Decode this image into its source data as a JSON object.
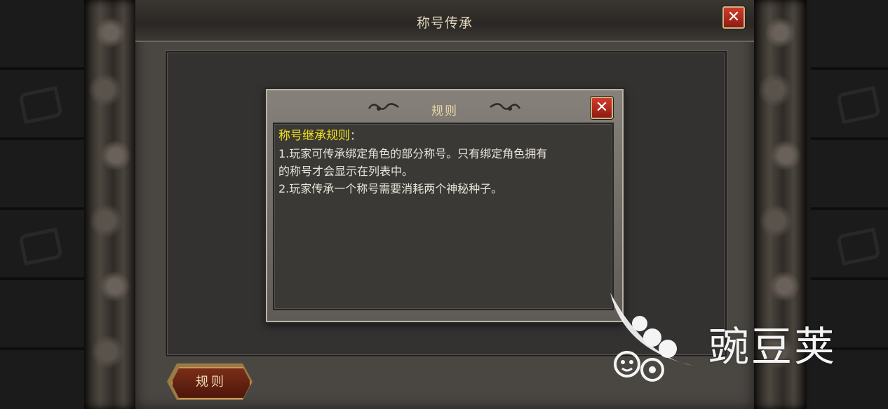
{
  "main_window": {
    "title": "称号传承",
    "close_icon": "✕",
    "rules_button_label": "规则"
  },
  "rules_dialog": {
    "title": "规则",
    "close_icon": "✕",
    "heading": "称号继承规则",
    "heading_suffix": "：",
    "lines": [
      "1.玩家可传承绑定角色的部分称号。只有绑定角色拥有",
      "的称号才会显示在列表中。",
      "2.玩家传承一个称号需要消耗两个神秘种子。"
    ]
  },
  "watermark": {
    "text": "豌豆荚",
    "logo_icon": "pea-pod-logo"
  },
  "colors": {
    "heading": "#f2e11a",
    "close_button": "#c0301f",
    "body_text": "#e9e4da"
  }
}
